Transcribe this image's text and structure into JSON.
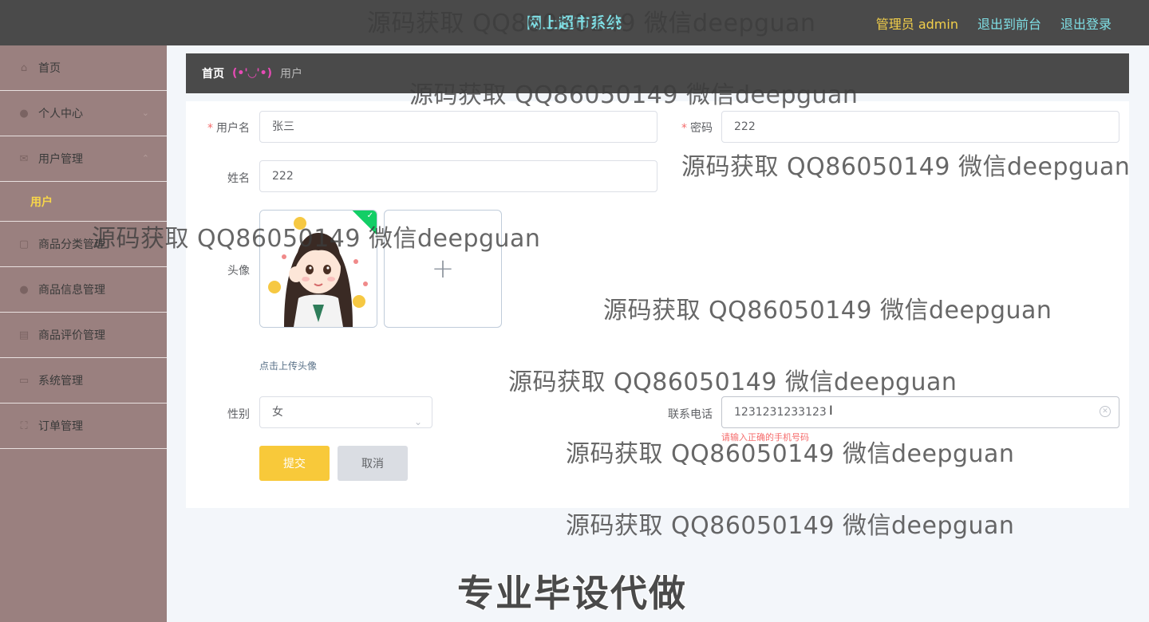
{
  "header": {
    "title": "网上超市系统",
    "admin_label": "管理员 admin",
    "front_link": "退出到前台",
    "logout_link": "退出登录"
  },
  "sidebar": {
    "items": [
      {
        "label": "首页",
        "icon": "home-icon"
      },
      {
        "label": "个人中心",
        "icon": "user-icon"
      },
      {
        "label": "用户管理",
        "icon": "mail-icon",
        "expanded": true
      },
      {
        "label": "商品分类管理",
        "icon": "doc-icon"
      },
      {
        "label": "商品信息管理",
        "icon": "user-icon"
      },
      {
        "label": "商品评价管理",
        "icon": "print-icon"
      },
      {
        "label": "系统管理",
        "icon": "monitor-icon"
      },
      {
        "label": "订单管理",
        "icon": "frame-icon"
      }
    ],
    "sub_item": "用户"
  },
  "breadcrumb": {
    "home": "首页",
    "separator": "(•'◡'•)",
    "current": "用户"
  },
  "form": {
    "username_label": "用户名",
    "username_value": "张三",
    "password_label": "密码",
    "password_value": "222",
    "name_label": "姓名",
    "name_value": "222",
    "avatar_label": "头像",
    "upload_tip": "点击上传头像",
    "gender_label": "性别",
    "gender_value": "女",
    "phone_label": "联系电话",
    "phone_value": "1231231233123",
    "phone_error": "请输入正确的手机号码",
    "submit_label": "提交",
    "cancel_label": "取消"
  },
  "watermarks": {
    "text": "源码获取 QQ86050149 微信deepguan",
    "footer": "专业毕设代做"
  },
  "colors": {
    "topbar": "#4a4a4a",
    "sidebar": "#9a807f",
    "accent_yellow": "#f8c93a",
    "accent_cyan": "#7fe0e6",
    "success": "#13ce66",
    "error": "#f56c6c"
  }
}
